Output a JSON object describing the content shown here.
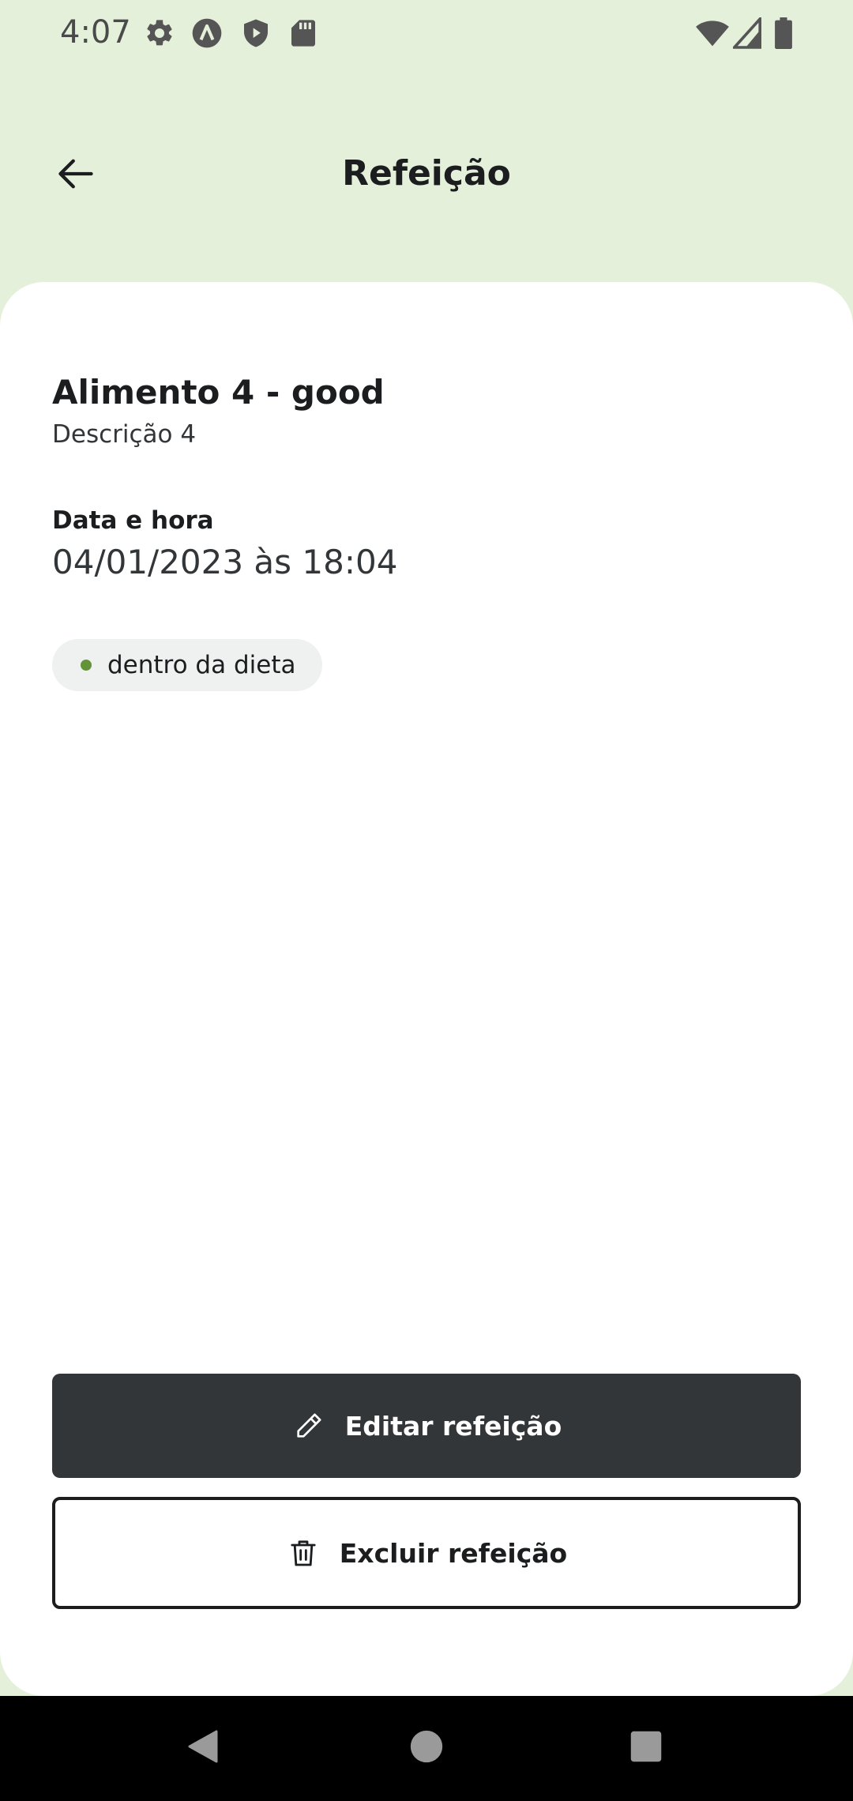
{
  "status_bar": {
    "time": "4:07",
    "left_icons": [
      "gear-icon",
      "a-circle-icon",
      "shield-play-icon",
      "sd-card-icon"
    ],
    "right_icons": [
      "wifi-icon",
      "cell-signal-icon",
      "battery-icon"
    ]
  },
  "header": {
    "title": "Refeição",
    "back_icon": "arrow-left-icon"
  },
  "meal": {
    "name": "Alimento 4 - good",
    "description": "Descrição 4",
    "datetime_label": "Data e hora",
    "datetime_value": "04/01/2023 às 18:04",
    "diet_status": {
      "label": "dentro da dieta",
      "dot_color": "#639339"
    }
  },
  "actions": {
    "edit_label": "Editar refeição",
    "edit_icon": "pencil-icon",
    "delete_label": "Excluir refeição",
    "delete_icon": "trash-icon"
  },
  "nav_bar": {
    "buttons": [
      "back-triangle-icon",
      "home-circle-icon",
      "recents-square-icon"
    ]
  },
  "colors": {
    "background": "#E5F0DB",
    "card": "#FFFFFF",
    "primary_dark": "#333638",
    "chip_bg": "#EFF0F0",
    "in_diet_green": "#639339"
  }
}
